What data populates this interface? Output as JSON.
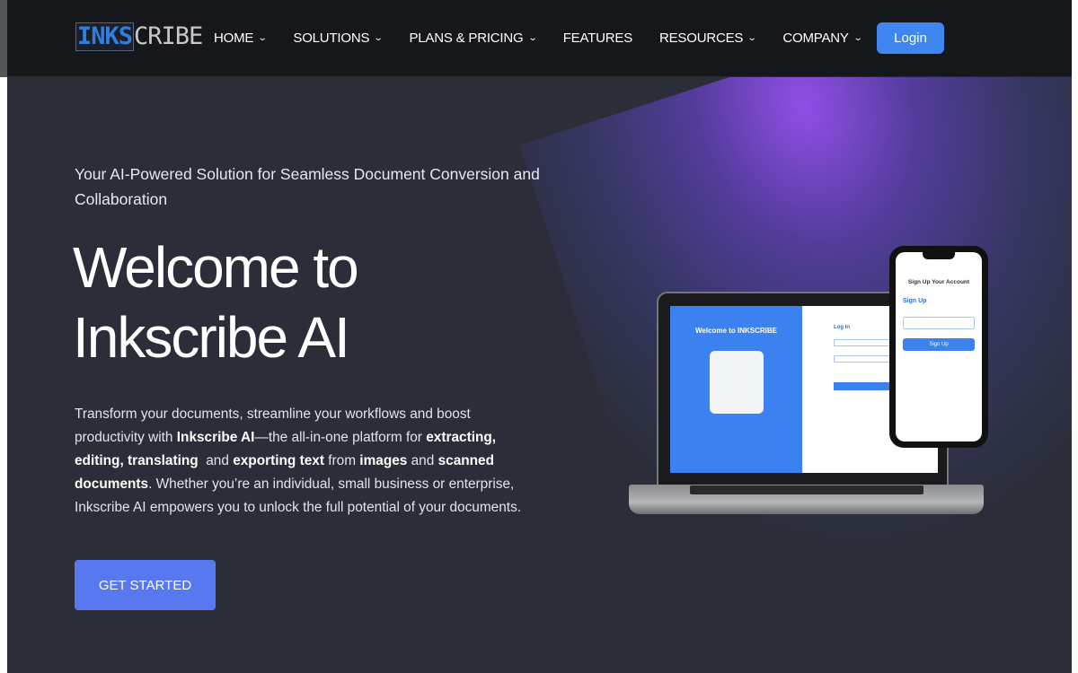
{
  "nav": {
    "logo": {
      "part1": "INKS",
      "part2": "CRIBE"
    },
    "items": [
      {
        "label": "HOME",
        "dropdown": true
      },
      {
        "label": "SOLUTIONS",
        "dropdown": true
      },
      {
        "label": "PLANS & PRICING",
        "dropdown": true
      },
      {
        "label": "FEATURES",
        "dropdown": false
      },
      {
        "label": "RESOURCES",
        "dropdown": true
      },
      {
        "label": "COMPANY",
        "dropdown": true
      }
    ],
    "chevron": "⌄",
    "login": "Login"
  },
  "hero": {
    "subtitle": "Your AI-Powered Solution for Seamless Document Conversion and Collaboration",
    "title_line1": "Welcome to",
    "title_line2": "Inkscribe AI",
    "description": [
      {
        "text": "Transform your documents, streamline your workflows and boost productivity with ",
        "bold": false
      },
      {
        "text": "Inkscribe AI",
        "bold": true
      },
      {
        "text": "—the all-in-one platform for ",
        "bold": false
      },
      {
        "text": "extracting, editing, translating",
        "bold": true
      },
      {
        "text": "  and ",
        "bold": false
      },
      {
        "text": "exporting text",
        "bold": true
      },
      {
        "text": " from ",
        "bold": false
      },
      {
        "text": "images",
        "bold": true
      },
      {
        "text": " and ",
        "bold": false
      },
      {
        "text": "scanned documents",
        "bold": true
      },
      {
        "text": ". Whether you’re an individual, small business or enterprise, Inkscribe AI empowers you to unlock the full potential of your documents.",
        "bold": false
      }
    ],
    "cta": "GET STARTED"
  },
  "mockup": {
    "laptop_welcome": "Welcome to INKSCRIBE",
    "laptop_login": "Log In",
    "phone_title": "Sign Up Your Account",
    "phone_signup": "Sign Up",
    "phone_button": "Sign Up"
  },
  "colors": {
    "nav_bg": "#16171a",
    "hero_bg": "#2b2e39",
    "login": "#3f86f1",
    "cta": "#5878ef",
    "glow": "#9650f0"
  }
}
